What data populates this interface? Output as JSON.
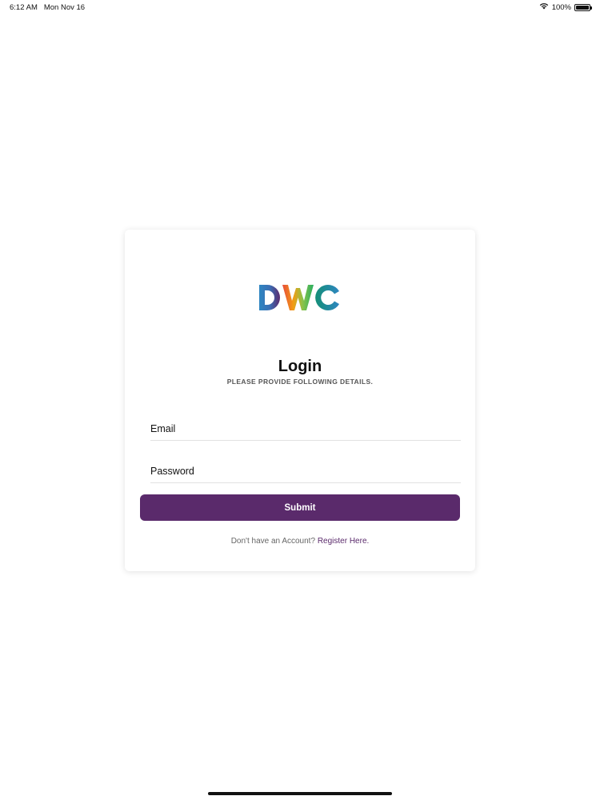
{
  "status_bar": {
    "time": "6:12 AM",
    "date": "Mon Nov 16",
    "battery": "100%",
    "battery_level": 1.0
  },
  "logo": {
    "text": "DWC",
    "colors": [
      "#2e86c1",
      "#5b2b6e",
      "#e74c3c",
      "#f39c12",
      "#27ae60",
      "#148f77",
      "#2e86c1"
    ]
  },
  "login": {
    "title": "Login",
    "subtitle": "PLEASE PROVIDE FOLLOWING DETAILS.",
    "email_placeholder": "Email",
    "password_placeholder": "Password",
    "submit_label": "Submit",
    "register_prompt": "Don't have an Account?",
    "register_link": "Register Here."
  },
  "colors": {
    "accent": "#5a2a6b"
  }
}
